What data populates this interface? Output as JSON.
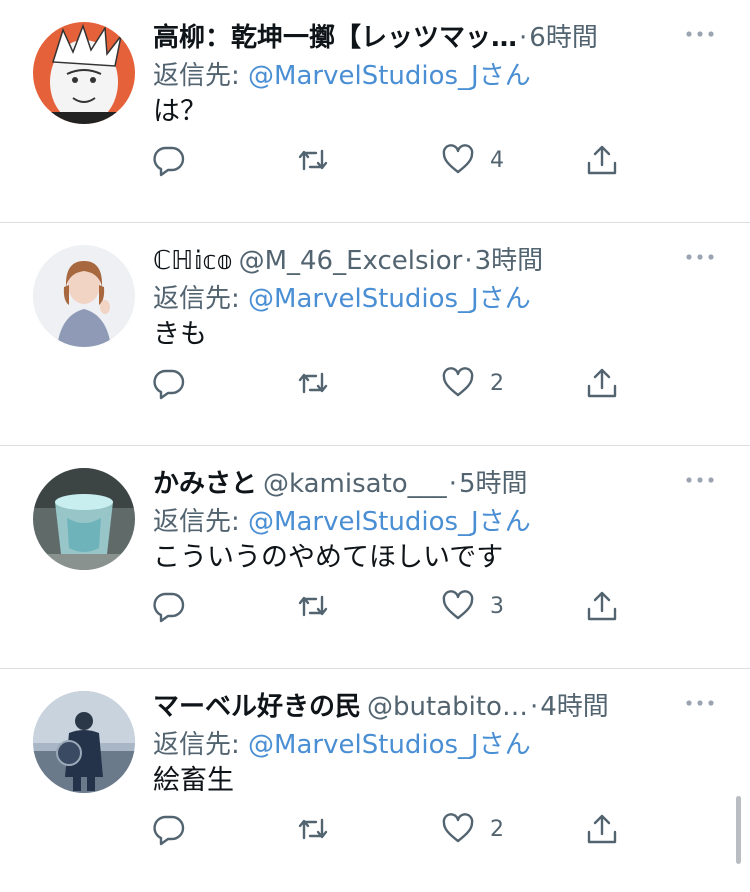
{
  "tweets": [
    {
      "name": "高柳：乾坤一擲【レッツマッ…",
      "handle": "",
      "separator": "·",
      "time": "6時間",
      "reply_prefix": "返信先: ",
      "reply_to": "@MarvelStudios_Jさん",
      "text": "は？",
      "reply_count": "",
      "retweet_count": "",
      "like_count": "4",
      "avatar_icon": "anime-character-avatar"
    },
    {
      "name": "ℂℍ𝕚𝕔𝕠",
      "handle": "@M_46_Excelsior",
      "separator": "·",
      "time": "3時間",
      "reply_prefix": "返信先: ",
      "reply_to": "@MarvelStudios_Jさん",
      "text": "きも",
      "reply_count": "",
      "retweet_count": "",
      "like_count": "2",
      "avatar_icon": "woman-photo-avatar"
    },
    {
      "name": "かみさと",
      "handle": "@kamisato___",
      "separator": "·",
      "time": "5時間",
      "reply_prefix": "返信先: ",
      "reply_to": "@MarvelStudios_Jさん",
      "text": "こういうのやめてほしいです",
      "reply_count": "",
      "retweet_count": "",
      "like_count": "3",
      "avatar_icon": "glass-photo-avatar"
    },
    {
      "name": "マーベル好きの民",
      "handle": "@butabito…",
      "separator": "·",
      "time": "4時間",
      "reply_prefix": "返信先: ",
      "reply_to": "@MarvelStudios_Jさん",
      "text": "絵畜生",
      "reply_count": "",
      "retweet_count": "",
      "like_count": "2",
      "avatar_icon": "hero-photo-avatar"
    }
  ],
  "colors": {
    "text": "#0f1419",
    "secondary": "#536471",
    "mention": "#4a8fd4",
    "divider": "#dcdde0"
  },
  "icons": [
    "reply-icon",
    "retweet-icon",
    "like-icon",
    "share-icon",
    "more-icon"
  ]
}
